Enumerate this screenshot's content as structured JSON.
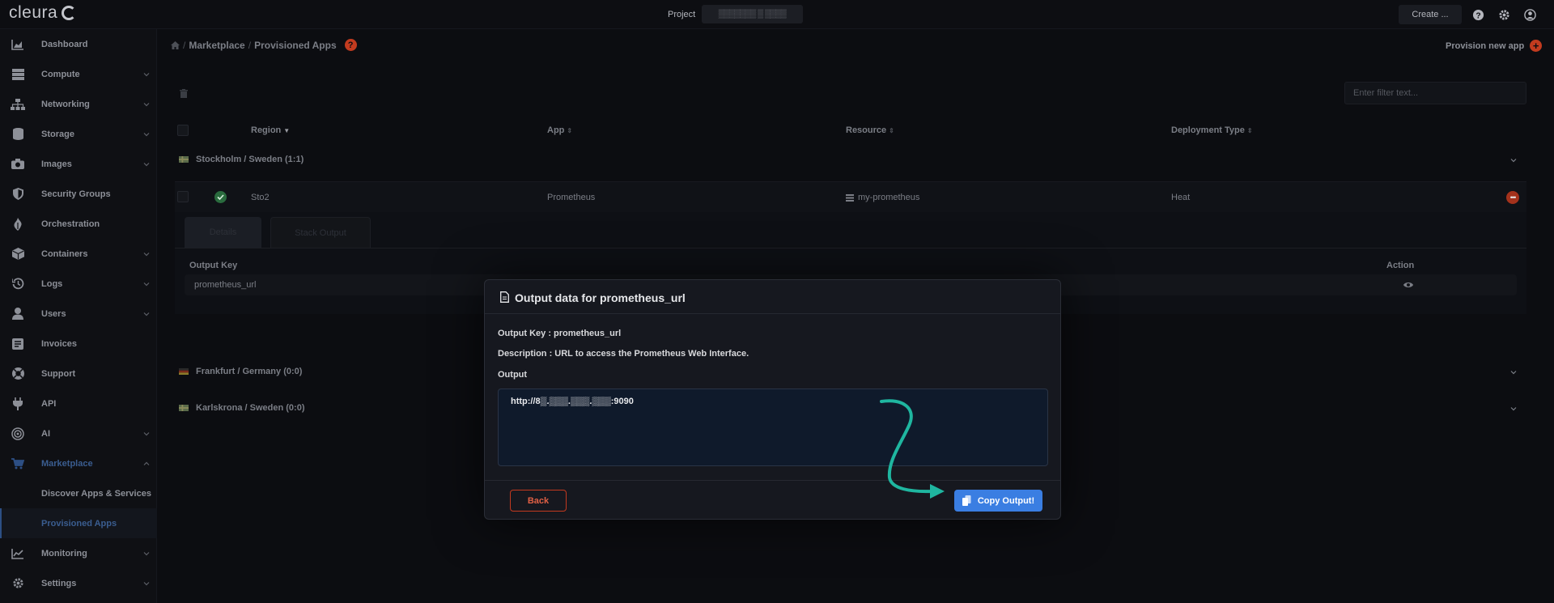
{
  "brand": {
    "name": "cleura"
  },
  "topbar": {
    "project_label": "Project",
    "project_value": "▒▒▒▒▒▒▒ ▒ ▒▒▒▒",
    "create_label": "Create ..."
  },
  "sidebar": {
    "items": [
      {
        "label": "Dashboard",
        "icon": "chart-area-icon"
      },
      {
        "label": "Compute",
        "icon": "server-icon"
      },
      {
        "label": "Networking",
        "icon": "network-icon"
      },
      {
        "label": "Storage",
        "icon": "database-icon"
      },
      {
        "label": "Images",
        "icon": "camera-icon"
      },
      {
        "label": "Security Groups",
        "icon": "shield-icon"
      },
      {
        "label": "Orchestration",
        "icon": "orchestration-icon"
      },
      {
        "label": "Containers",
        "icon": "cube-icon"
      },
      {
        "label": "Logs",
        "icon": "history-icon"
      },
      {
        "label": "Users",
        "icon": "user-icon"
      },
      {
        "label": "Invoices",
        "icon": "invoice-icon"
      },
      {
        "label": "Support",
        "icon": "lifebuoy-icon"
      },
      {
        "label": "API",
        "icon": "plug-icon"
      },
      {
        "label": "AI",
        "icon": "ai-icon"
      },
      {
        "label": "Marketplace",
        "icon": "cart-icon"
      },
      {
        "label": "Discover Apps & Services"
      },
      {
        "label": "Provisioned Apps"
      },
      {
        "label": "Monitoring",
        "icon": "chart-line-icon"
      },
      {
        "label": "Settings",
        "icon": "gear-icon"
      }
    ]
  },
  "breadcrumb": {
    "part1": "Marketplace",
    "part2": "Provisioned Apps",
    "sep": "/"
  },
  "provision_label": "Provision new app",
  "filter_placeholder": "Enter filter text...",
  "table": {
    "headers": {
      "region": "Region",
      "app": "App",
      "resource": "Resource",
      "deployment": "Deployment Type"
    },
    "groups": [
      {
        "label": "Stockholm / Sweden (1:1)"
      },
      {
        "label": "Frankfurt / Germany (0:0)"
      },
      {
        "label": "Karlskrona / Sweden (0:0)"
      }
    ],
    "row": {
      "region": "Sto2",
      "app": "Prometheus",
      "resource": "my-prometheus",
      "deployment": "Heat"
    },
    "tabs": {
      "details": "Details",
      "outputs": "Stack Output"
    },
    "output_headers": {
      "key": "Output Key",
      "action": "Action"
    },
    "output_key": "prometheus_url"
  },
  "modal": {
    "title": "Output data for prometheus_url",
    "key_line": "Output Key : prometheus_url",
    "description_line": "Description : URL to access the Prometheus Web Interface.",
    "output_label": "Output",
    "output_value": "http://8▒.▒▒▒.▒▒▒.▒▒▒:9090",
    "back_label": "Back",
    "copy_label": "Copy Output!"
  },
  "colors": {
    "accent": "#3a7ee2",
    "danger": "#c23b1f",
    "success": "#2a6b3e",
    "arrow": "#1fb6a0"
  }
}
